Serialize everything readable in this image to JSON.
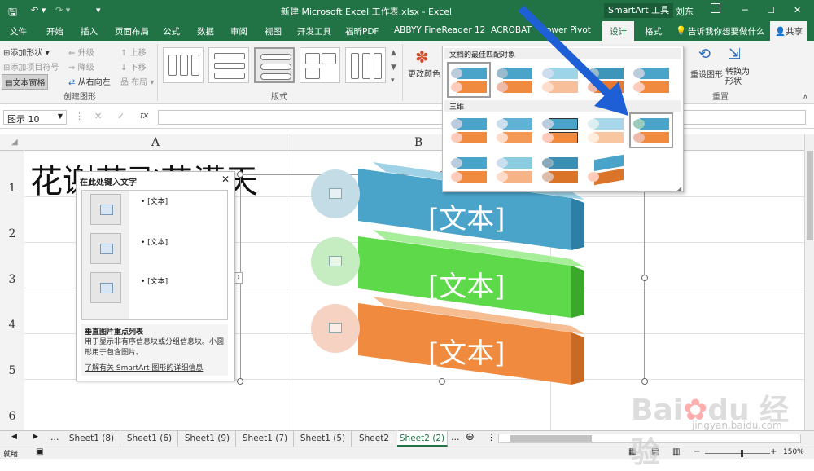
{
  "titlebar": {
    "title": "新建 Microsoft Excel 工作表.xlsx  -  Excel",
    "context": "SmartArt 工具",
    "user": "刘东"
  },
  "tabs": [
    "文件",
    "开始",
    "插入",
    "页面布局",
    "公式",
    "数据",
    "审阅",
    "视图",
    "开发工具",
    "福昕PDF",
    "ABBYY FineReader 12",
    "ACROBAT",
    "Power Pivot",
    "设计",
    "格式"
  ],
  "tellme": "告诉我你想要做什么",
  "share": "共享",
  "ribbon": {
    "add_shape": "添加形状",
    "add_bullet": "添加项目符号",
    "text_pane": "文本窗格",
    "promote": "升级",
    "demote": "降级",
    "rtl": "从右向左",
    "move_up": "上移",
    "move_down": "下移",
    "layout": "布局",
    "group_create": "创建图形",
    "group_layout": "版式",
    "change_colors": "更改颜色",
    "reset": "重设图形",
    "convert": "转换为形状",
    "group_reset": "重置"
  },
  "namebox": "图示 10",
  "columns": [
    "A",
    "B"
  ],
  "rows": [
    "1",
    "2",
    "3",
    "4",
    "5",
    "6"
  ],
  "cell_text": "花谢花飞花满天",
  "pane": {
    "title": "在此处键入文字",
    "bullets": [
      "[文本]",
      "[文本]",
      "[文本]"
    ],
    "desc_title": "垂直图片重点列表",
    "desc": "用于显示非有序信息块或分组信息块。小圆形用于包含图片。",
    "link": "了解有关 SmartArt 图形的详细信息"
  },
  "gallery": {
    "section1": "文档的最佳匹配对象",
    "section2": "三维"
  },
  "smartart": {
    "items": [
      "[文本]",
      "[文本]",
      "[文本]"
    ],
    "colors": [
      "#4aa3c8",
      "#5dd94a",
      "#f08a3e"
    ]
  },
  "sheets": [
    "Sheet1 (8)",
    "Sheet1 (6)",
    "Sheet1 (9)",
    "Sheet1 (7)",
    "Sheet1 (5)",
    "Sheet2",
    "Sheet2 (2)"
  ],
  "status": {
    "mode": "就绪",
    "zoom": "150%"
  },
  "watermark": "jingyan.baidu.com"
}
